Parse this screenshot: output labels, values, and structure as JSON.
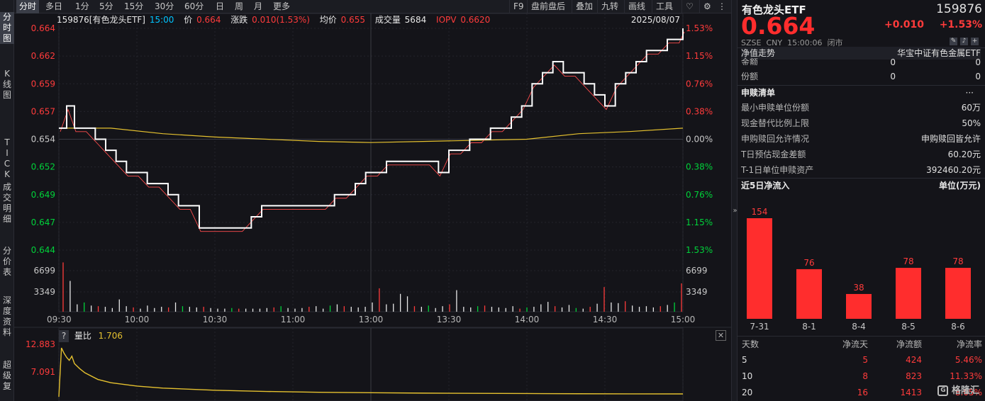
{
  "left_bar": [
    "分时图",
    "K线图",
    "TICK",
    "成交明细",
    "分价表",
    "深度资料",
    "超级复"
  ],
  "toolbar": {
    "periods": [
      "分时",
      "多日",
      "1分",
      "5分",
      "15分",
      "30分",
      "60分",
      "日",
      "周",
      "月",
      "更多"
    ],
    "tools": [
      "F9",
      "盘前盘后",
      "叠加",
      "九转",
      "画线",
      "工具"
    ],
    "heart_icon": "heart-icon",
    "settings_icon": "settings-icon"
  },
  "info_bar": {
    "code_name": "159876[有色龙头ETF]",
    "time": "15:00",
    "price_label": "价",
    "price": "0.664",
    "change_label": "涨跌",
    "change": "0.010(1.53%)",
    "avg_label": "均价",
    "avg": "0.655",
    "volume_label": "成交量",
    "volume": "5684",
    "iopv_label": "IOPV",
    "iopv": "0.6620",
    "date": "2025/08/07"
  },
  "chart_data": [
    {
      "type": "line",
      "y_left_ticks": [
        "0.664",
        "0.662",
        "0.659",
        "0.657",
        "0.654",
        "0.652",
        "0.649",
        "0.647",
        "0.644"
      ],
      "y_right_ticks": [
        "1.53%",
        "1.15%",
        "0.76%",
        "0.38%",
        "0.00%",
        "0.38%",
        "0.76%",
        "1.15%",
        "1.53%"
      ],
      "x_ticks": [
        "09:30",
        "10:00",
        "10:30",
        "11:00",
        "13:00",
        "13:30",
        "14:00",
        "14:30",
        "15:00"
      ],
      "ylim": [
        0.644,
        0.664
      ],
      "prev_close": 0.654,
      "series": [
        {
          "x": [
            0,
            3,
            6,
            10,
            14,
            18,
            22,
            26,
            30,
            34,
            38,
            42,
            46,
            50,
            54,
            58,
            62,
            66,
            70,
            74,
            78,
            82,
            86,
            90,
            94,
            98,
            102,
            106,
            110,
            114,
            118,
            122,
            126,
            130,
            134,
            138,
            142,
            146,
            150,
            154,
            158,
            162,
            166,
            170,
            174,
            178,
            182,
            186,
            190,
            194,
            198,
            202,
            206,
            210,
            214,
            218,
            222,
            226,
            230,
            234,
            238,
            240
          ],
          "values": [
            0.655,
            0.657,
            0.655,
            0.655,
            0.654,
            0.653,
            0.652,
            0.651,
            0.651,
            0.65,
            0.65,
            0.649,
            0.648,
            0.648,
            0.646,
            0.646,
            0.646,
            0.646,
            0.646,
            0.647,
            0.648,
            0.648,
            0.648,
            0.648,
            0.648,
            0.648,
            0.648,
            0.649,
            0.649,
            0.65,
            0.651,
            0.651,
            0.652,
            0.652,
            0.652,
            0.652,
            0.652,
            0.651,
            0.653,
            0.653,
            0.654,
            0.654,
            0.655,
            0.655,
            0.656,
            0.657,
            0.659,
            0.66,
            0.661,
            0.66,
            0.66,
            0.659,
            0.658,
            0.657,
            0.659,
            0.66,
            0.661,
            0.662,
            0.662,
            0.663,
            0.663,
            0.664
          ]
        },
        {
          "x": [
            0,
            20,
            40,
            60,
            80,
            100,
            120,
            140,
            160,
            180,
            200,
            220,
            240
          ],
          "values": [
            0.655,
            0.655,
            0.6545,
            0.6542,
            0.654,
            0.6538,
            0.6537,
            0.6538,
            0.6539,
            0.654,
            0.6545,
            0.6547,
            0.655
          ]
        }
      ]
    },
    {
      "type": "bar",
      "y_ticks": [
        "6699",
        "3349"
      ],
      "ylim": [
        0,
        10000
      ],
      "values": [
        8000,
        5000,
        1200,
        1500,
        1000,
        900,
        800,
        600,
        2000,
        900,
        700,
        500,
        1000,
        600,
        800,
        700,
        1500,
        900,
        800,
        700,
        800,
        600,
        500,
        500,
        600,
        500,
        500,
        500,
        500,
        600,
        700,
        900,
        600,
        500,
        600,
        800,
        900,
        500,
        1000,
        1200,
        900,
        800,
        700,
        800,
        1500,
        3800,
        1200,
        1300,
        2900,
        2500,
        900,
        800,
        1000,
        600,
        900,
        1200,
        3500,
        800,
        700,
        900,
        1000,
        800,
        700,
        600,
        900,
        500,
        700,
        800,
        1200,
        1600,
        900,
        700,
        1100,
        600,
        500,
        800,
        1300,
        4000,
        1500,
        1400,
        1700,
        1000,
        800,
        900,
        700,
        900,
        1100,
        1500,
        4600
      ]
    },
    {
      "type": "line",
      "title": "量比",
      "label_value": "1.706",
      "y_ticks": [
        "12.883",
        "7.091"
      ],
      "ylim": [
        0,
        14
      ],
      "x": [
        0,
        1,
        2,
        3,
        4,
        5,
        6,
        8,
        10,
        15,
        20,
        30,
        40,
        60,
        80,
        100,
        120,
        140,
        160,
        180,
        200,
        220,
        240
      ],
      "values": [
        1.0,
        12.8,
        11.5,
        10.5,
        9.8,
        10.8,
        9.0,
        7.8,
        6.8,
        5.2,
        4.4,
        3.6,
        3.1,
        2.6,
        2.3,
        2.1,
        2.0,
        1.9,
        1.85,
        1.8,
        1.75,
        1.72,
        1.706
      ]
    }
  ],
  "right_panel": {
    "name": "有色龙头ETF",
    "code": "159876",
    "price": "0.664",
    "change": "+0.010",
    "change_pct": "+1.53%",
    "exchange": "SZSE",
    "currency": "CNY",
    "time": "15:00:06",
    "status": "闭市",
    "nav_label": "净值走势",
    "nav_value": "华宝中证有色金属ETF",
    "amount_rows": [
      {
        "label": "金额",
        "v1": "0",
        "v2": "0"
      },
      {
        "label": "份额",
        "v1": "0",
        "v2": "0"
      }
    ],
    "creation_title": "申赎清单",
    "creation_more": "···",
    "creation_rows": [
      {
        "label": "最小申赎单位份额",
        "value": "60万"
      },
      {
        "label": "现金替代比例上限",
        "value": "50%"
      },
      {
        "label": "申购赎回允许情况",
        "value": "申购赎回皆允许"
      },
      {
        "label": "T日预估现金差额",
        "value": "60.20元"
      },
      {
        "label": "T-1日单位申赎资产",
        "value": "392460.20元"
      }
    ],
    "inflow_title": "近5日净流入",
    "inflow_unit": "单位(万元)",
    "inflow_chart": {
      "type": "bar",
      "categories": [
        "7-31",
        "8-1",
        "8-4",
        "8-5",
        "8-6"
      ],
      "values": [
        154,
        76,
        38,
        78,
        78
      ],
      "color": "#ff2d2d"
    },
    "stats_headers": [
      "天数",
      "净流天",
      "净流额",
      "净流率"
    ],
    "stats_rows": [
      [
        "5",
        "5",
        "424",
        "5.46%"
      ],
      [
        "10",
        "8",
        "823",
        "11.33%"
      ],
      [
        "20",
        "16",
        "1413",
        "8.05%"
      ]
    ],
    "watermark": "格隆汇"
  },
  "colors": {
    "up": "#ff3b3b",
    "down": "#00d23a",
    "price_line": "#ffffff",
    "avg_line": "#e5c12f",
    "red_line": "#ff4d4d"
  }
}
